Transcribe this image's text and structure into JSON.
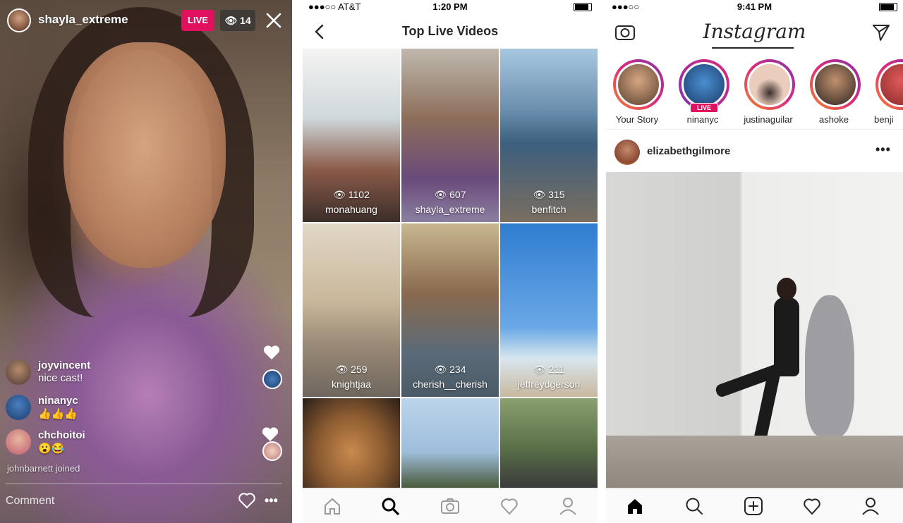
{
  "live": {
    "username": "shayla_extreme",
    "live_badge": "LIVE",
    "viewer_count": "14",
    "comments": [
      {
        "name": "joyvincent",
        "text": "nice cast!"
      },
      {
        "name": "ninanyc",
        "text": "👍👍👍"
      },
      {
        "name": "chchoitoi",
        "text": "😮😂"
      }
    ],
    "joined_notice": "johnbarnett joined",
    "comment_placeholder": "Comment",
    "more_label": "•••"
  },
  "explore": {
    "status": {
      "carrier": "●●●○○ AT&T",
      "time": "1:20 PM"
    },
    "title": "Top Live Videos",
    "tiles": [
      {
        "views": "👁 1102",
        "user": "monahuang"
      },
      {
        "views": "👁 607",
        "user": "shayla_extreme"
      },
      {
        "views": "👁 315",
        "user": "benfitch"
      },
      {
        "views": "👁 259",
        "user": "knightjaa"
      },
      {
        "views": "👁 234",
        "user": "cherish__cherish"
      },
      {
        "views": "👁 211",
        "user": "jeffreydgerson"
      }
    ]
  },
  "feed": {
    "status": {
      "carrier": "●●●○○",
      "time": "9:41 PM"
    },
    "logo": "Instagram",
    "stories": [
      {
        "label": "Your Story",
        "live": false
      },
      {
        "label": "ninanyc",
        "live": true,
        "live_label": "LIVE"
      },
      {
        "label": "justinaguilar",
        "live": false
      },
      {
        "label": "ashoke",
        "live": false
      },
      {
        "label": "benji",
        "live": false
      }
    ],
    "post": {
      "user": "elizabethgilmore",
      "more": "•••"
    }
  },
  "colors": {
    "live_pink": "#e0125f",
    "story_gradient": [
      "#f58529",
      "#dd2a7b",
      "#8134af"
    ]
  }
}
